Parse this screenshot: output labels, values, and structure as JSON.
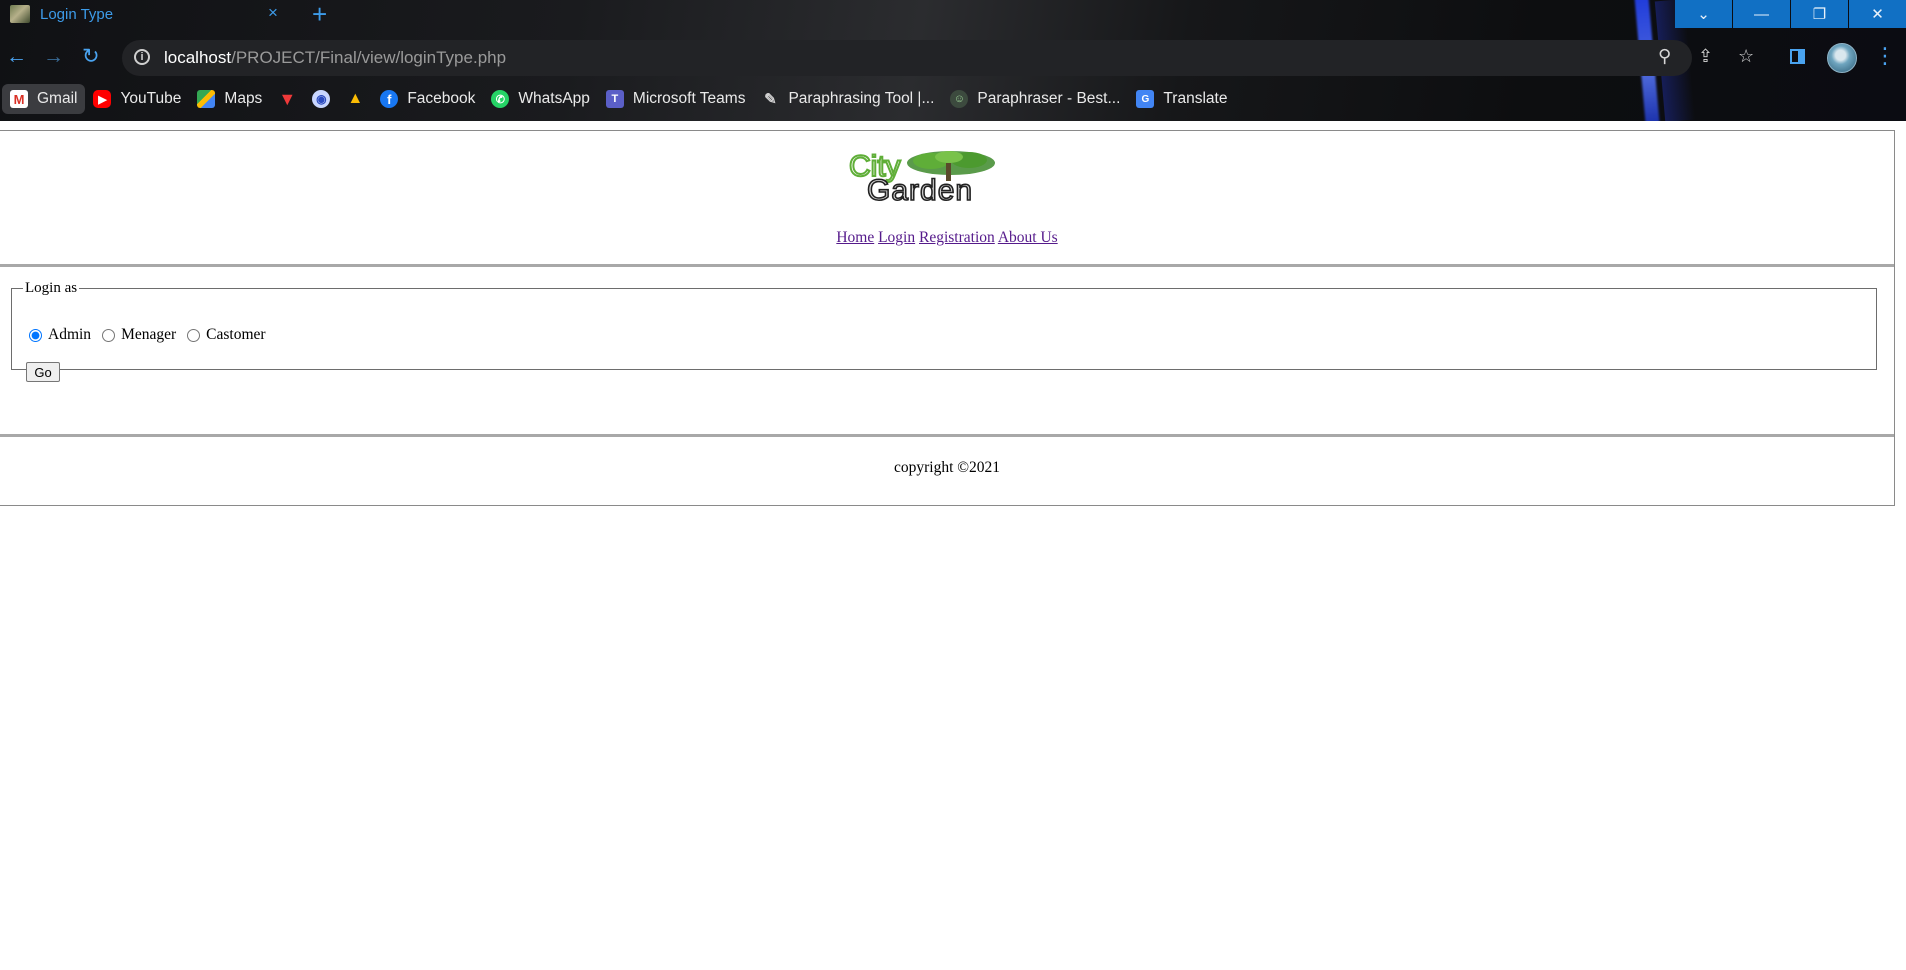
{
  "browser": {
    "tab_title": "Login Type",
    "tab_close": "×",
    "new_tab": "+",
    "window_buttons": [
      "⌄",
      "—",
      "❐",
      "✕"
    ],
    "url_host": "localhost",
    "url_path": "/PROJECT/Final/view/loginType.php",
    "accent_color": "#3d9be9",
    "bookmarks": [
      {
        "label": "Gmail",
        "icon": "gmail-icon"
      },
      {
        "label": "YouTube",
        "icon": "youtube-icon"
      },
      {
        "label": "Maps",
        "icon": "maps-icon"
      },
      {
        "label": "",
        "icon": "vivaldi-v-icon"
      },
      {
        "label": "",
        "icon": "privacy-shield-icon"
      },
      {
        "label": "",
        "icon": "google-drive-icon"
      },
      {
        "label": "Facebook",
        "icon": "facebook-icon"
      },
      {
        "label": "WhatsApp",
        "icon": "whatsapp-icon"
      },
      {
        "label": "Microsoft Teams",
        "icon": "teams-icon"
      },
      {
        "label": "Paraphrasing Tool |...",
        "icon": "quill-icon"
      },
      {
        "label": "Paraphraser - Best...",
        "icon": "paraphraser-icon"
      },
      {
        "label": "Translate",
        "icon": "translate-icon"
      }
    ]
  },
  "page": {
    "logo_alt": "City Garden",
    "nav": [
      "Home",
      "Login",
      "Registration",
      "About Us"
    ],
    "form": {
      "legend": "Login as",
      "options": [
        "Admin",
        "Menager",
        "Castomer"
      ],
      "selected": "Admin",
      "submit": "Go"
    },
    "footer": "copyright ©2021",
    "link_color": "#551a8b"
  }
}
